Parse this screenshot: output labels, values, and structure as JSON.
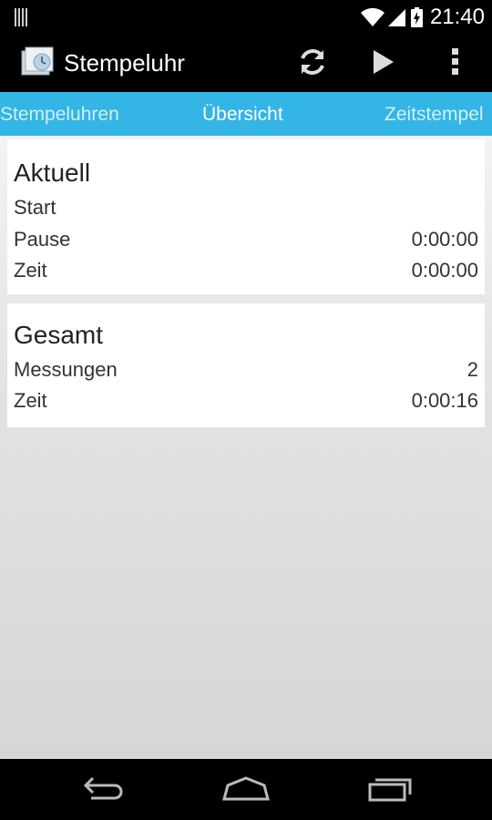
{
  "status_bar": {
    "time": "21:40",
    "icons": [
      "barcode-icon",
      "wifi-icon",
      "signal-icon",
      "battery-charging-icon"
    ]
  },
  "action_bar": {
    "title": "Stempeluhr",
    "app_icon": "stamp-clock-icon",
    "actions": [
      "refresh-icon",
      "play-icon",
      "overflow-menu-icon"
    ]
  },
  "tabs": {
    "left": "Stempeluhren",
    "center": "Übersicht",
    "right": "Zeitstempel"
  },
  "current": {
    "heading": "Aktuell",
    "rows": [
      {
        "label": "Start",
        "value": ""
      },
      {
        "label": "Pause",
        "value": "0:00:00"
      },
      {
        "label": "Zeit",
        "value": "0:00:00"
      }
    ]
  },
  "total": {
    "heading": "Gesamt",
    "rows": [
      {
        "label": "Messungen",
        "value": "2"
      },
      {
        "label": "Zeit",
        "value": "0:00:16"
      }
    ]
  },
  "nav_bar": {
    "buttons": [
      "back-icon",
      "home-icon",
      "recent-apps-icon"
    ]
  },
  "colors": {
    "tab_strip": "#33b5e5",
    "action_bar": "#000000",
    "card": "#ffffff"
  }
}
